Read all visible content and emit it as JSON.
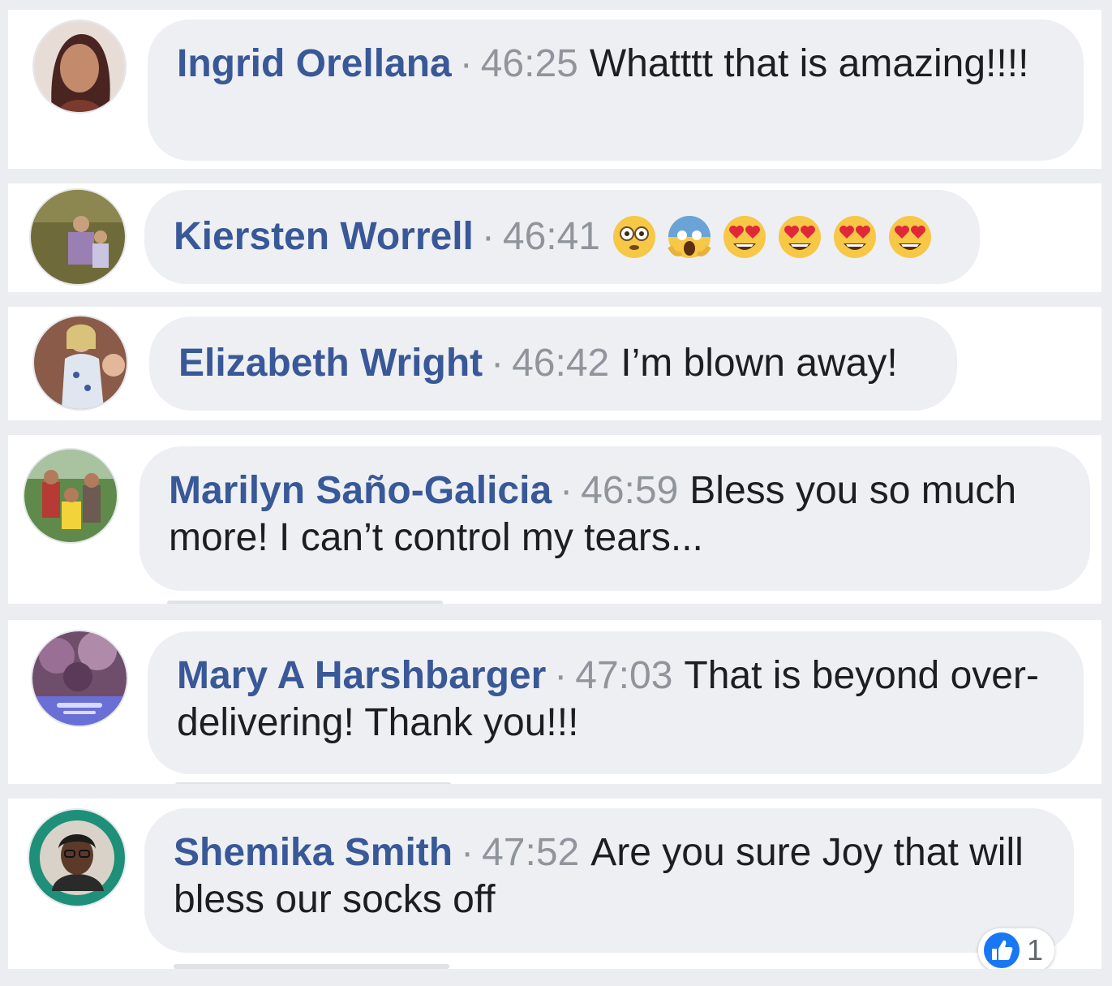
{
  "comments": [
    {
      "name": "Ingrid Orellana",
      "separator": "·",
      "time": "46:25",
      "text": "Whatttt that is amazing!!!!"
    },
    {
      "name": "Kiersten Worrell",
      "separator": "·",
      "time": "46:41",
      "text": "",
      "emojis": [
        "flushed-face-emoji",
        "screaming-face-emoji",
        "heart-eyes-emoji",
        "heart-eyes-emoji",
        "heart-eyes-emoji",
        "heart-eyes-emoji"
      ]
    },
    {
      "name": "Elizabeth Wright",
      "separator": "·",
      "time": "46:42",
      "text": "I’m blown away!"
    },
    {
      "name": "Marilyn Saño-Galicia",
      "separator": "·",
      "time": "46:59",
      "text": "Bless you so much more! I can’t control my tears..."
    },
    {
      "name": "Mary A Harshbarger",
      "separator": "·",
      "time": "47:03",
      "text": "That is beyond over-delivering! Thank you!!!"
    },
    {
      "name": "Shemika Smith",
      "separator": "·",
      "time": "47:52",
      "text": "Are you sure Joy that will bless our socks off",
      "reactions": {
        "icon": "like-icon",
        "count": "1"
      }
    }
  ],
  "colors": {
    "name_link": "#385898",
    "timestamp": "#90949c",
    "bubble": "#eeeff2",
    "like_blue": "#1877f2"
  }
}
